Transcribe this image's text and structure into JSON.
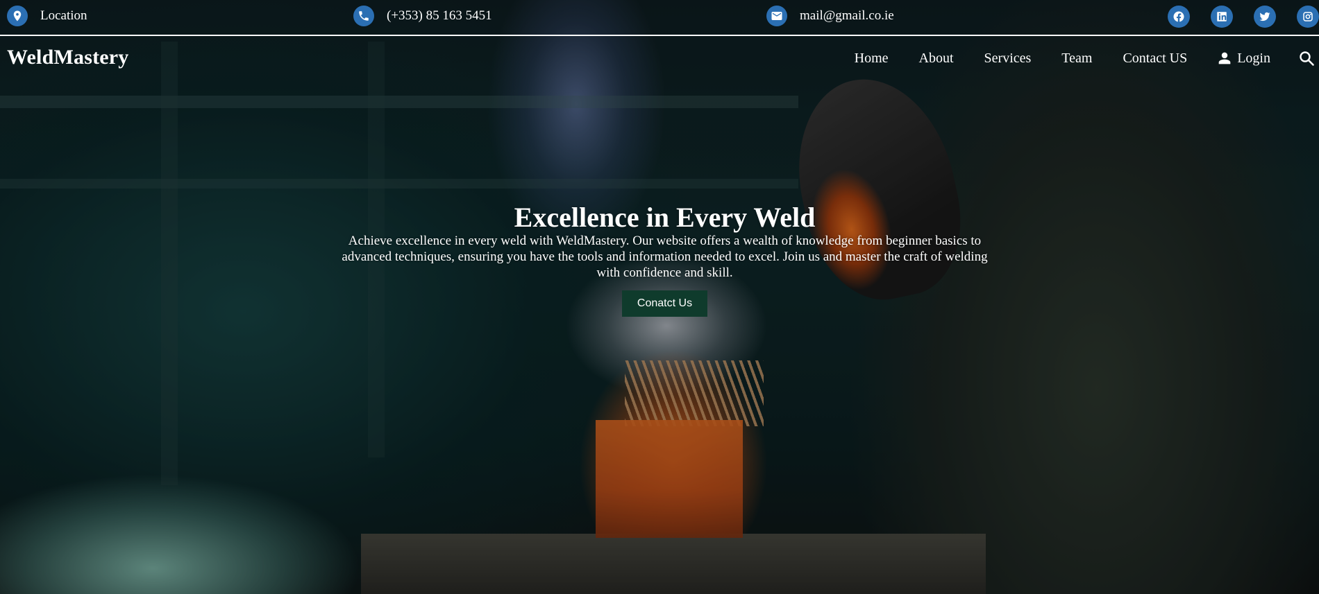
{
  "topbar": {
    "location": {
      "icon": "map-pin-icon",
      "text": "Location"
    },
    "phone": {
      "icon": "phone-icon",
      "text": "(+353) 85 163 5451"
    },
    "email": {
      "icon": "envelope-icon",
      "text": "mail@gmail.co.ie"
    },
    "social": [
      "facebook-icon",
      "linkedin-icon",
      "twitter-icon",
      "instagram-icon"
    ],
    "icon_color": "#2b6fb3"
  },
  "navbar": {
    "brand": "WeldMastery",
    "items": [
      "Home",
      "About",
      "Services",
      "Team",
      "Contact US"
    ],
    "login": "Login"
  },
  "hero": {
    "title": "Excellence in Every Weld",
    "description": "Achieve excellence in every weld with WeldMastery. Our website offers a wealth of knowledge from beginner basics to advanced techniques, ensuring you have the tools and information needed to excel. Join us and master the craft of welding with confidence and skill.",
    "cta": "Conatct Us",
    "cta_color": "#0f3b2c"
  }
}
